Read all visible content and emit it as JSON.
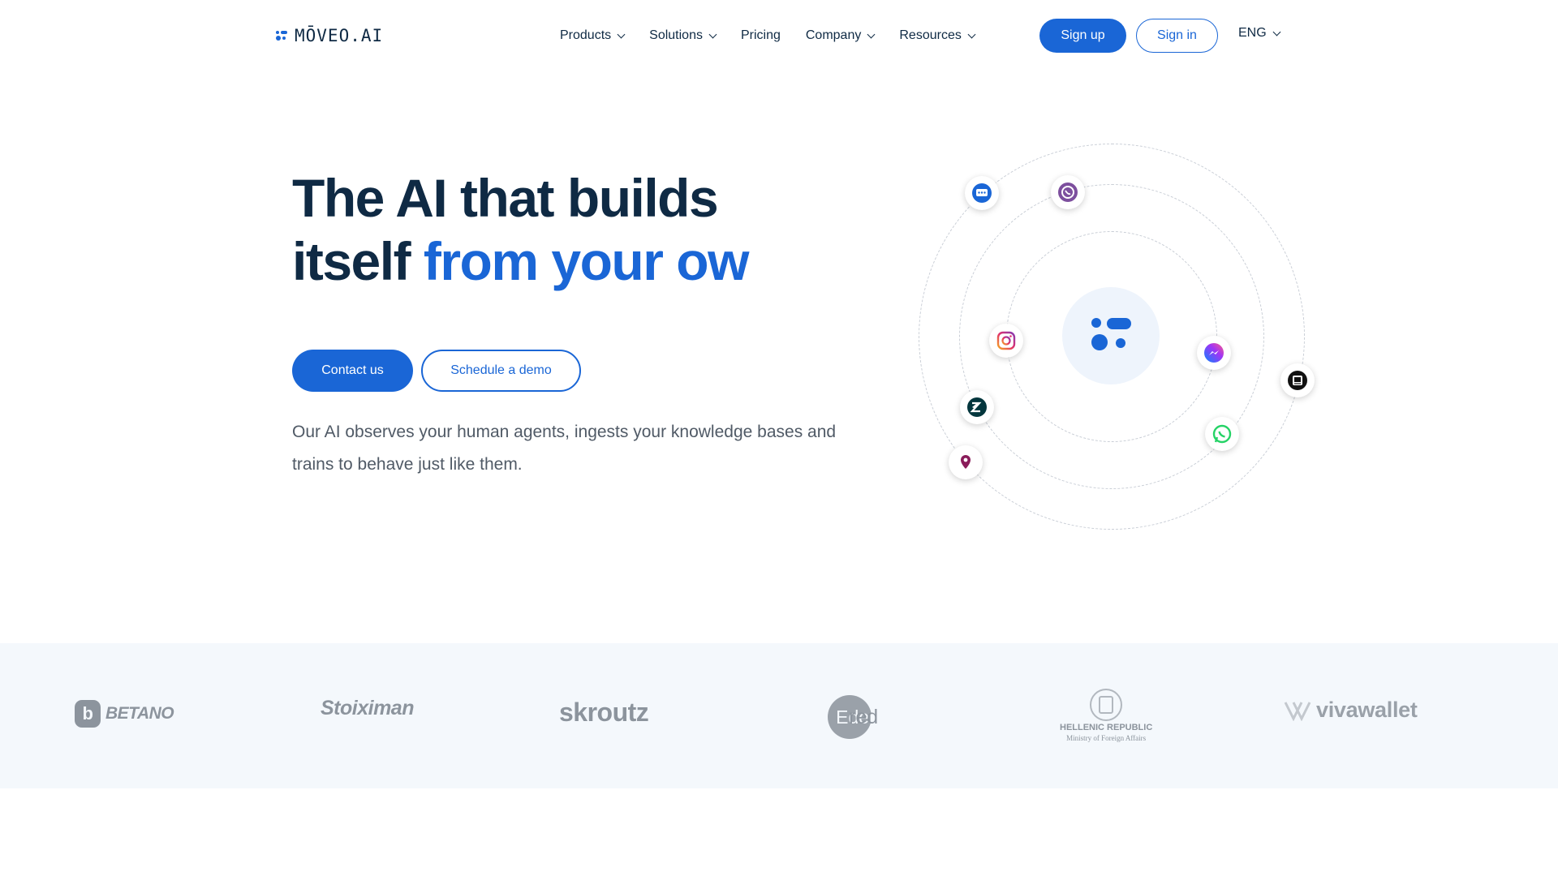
{
  "nav": {
    "logo_text": "MŌVEO.AI",
    "items": [
      {
        "label": "Products",
        "dropdown": true
      },
      {
        "label": "Solutions",
        "dropdown": true
      },
      {
        "label": "Pricing",
        "dropdown": false
      },
      {
        "label": "Company",
        "dropdown": true
      },
      {
        "label": "Resources",
        "dropdown": true
      }
    ],
    "signup_label": "Sign up",
    "signin_label": "Sign in",
    "language": "ENG"
  },
  "hero": {
    "title_line1": "The AI that builds",
    "title_line2_dark": "itself ",
    "title_line2_blue": "from your ow",
    "contact_label": "Contact us",
    "demo_label": "Schedule a demo",
    "description": "Our AI observes your human agents, ingests your knowledge bases and trains to behave just like them."
  },
  "channels": [
    "chat-icon",
    "viber-icon",
    "instagram-icon",
    "messenger-icon",
    "intercom-icon",
    "zendesk-icon",
    "whatsapp-icon",
    "location-icon"
  ],
  "brands": {
    "betano": "BETANO",
    "stoiximan": "Stoiximan",
    "skroutz": "skroutz",
    "edenred_circle": "Eden",
    "edenred_rest": "red",
    "hellenic_line1": "HELLENIC REPUBLIC",
    "hellenic_line2": "Ministry of Foreign Affairs",
    "vivawallet": "vivawallet"
  },
  "colors": {
    "brand_blue": "#1a66d6",
    "heading": "#0f2a44",
    "strip_bg": "#f4f8fc",
    "logo_gray": "#8c949d"
  }
}
